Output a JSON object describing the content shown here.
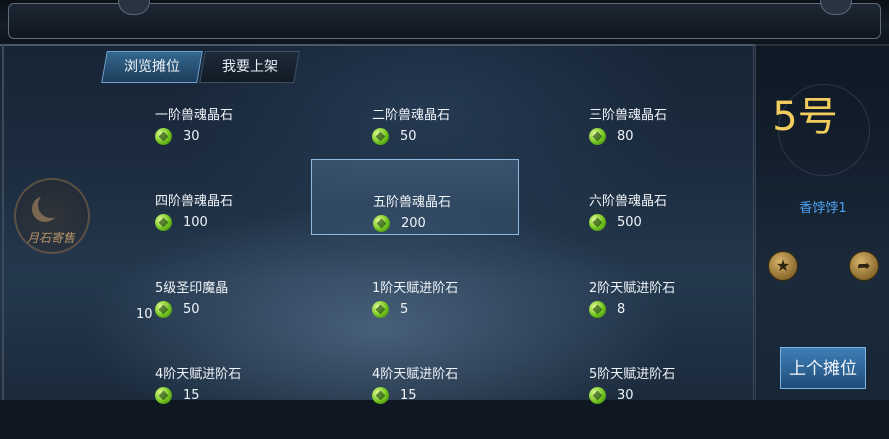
{
  "tabs": {
    "browse": "浏览摊位",
    "sell": "我要上架"
  },
  "seal_text": "月石寄售",
  "stall": {
    "number": "5号",
    "owner": "香饽饽1",
    "prev_button": "上个摊位"
  },
  "items": [
    {
      "name": "一阶兽魂晶石",
      "price": "30"
    },
    {
      "name": "二阶兽魂晶石",
      "price": "50"
    },
    {
      "name": "三阶兽魂晶石",
      "price": "80"
    },
    {
      "name": "四阶兽魂晶石",
      "price": "100"
    },
    {
      "name": "五阶兽魂晶石",
      "price": "200",
      "selected": true
    },
    {
      "name": "六阶兽魂晶石",
      "price": "500"
    },
    {
      "name": "5级圣印魔晶",
      "price": "50",
      "quantity": "10"
    },
    {
      "name": "1阶天赋进阶石",
      "price": "5"
    },
    {
      "name": "2阶天赋进阶石",
      "price": "8"
    },
    {
      "name": "4阶天赋进阶石",
      "price": "15"
    },
    {
      "name": "4阶天赋进阶石",
      "price": "15"
    },
    {
      "name": "5阶天赋进阶石",
      "price": "30"
    }
  ],
  "icons": {
    "currency": "green-gem-icon",
    "favorite": "star-icon",
    "share": "share-arrow-icon"
  }
}
